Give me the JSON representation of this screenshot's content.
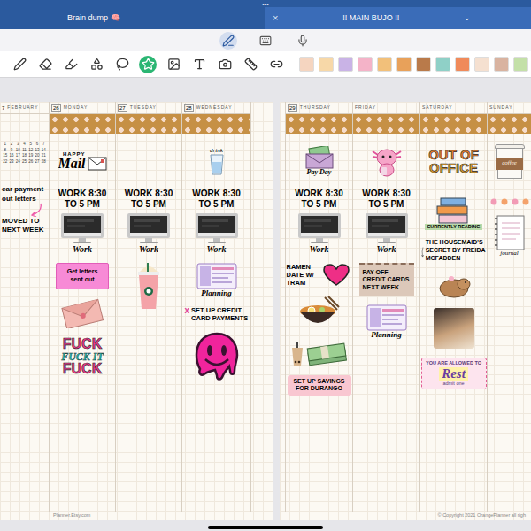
{
  "tab_bar": {
    "more": "•••",
    "close": "×",
    "menu": "⌄"
  },
  "tabs": [
    {
      "label": "Brain dump 🧠",
      "selected": false
    },
    {
      "label": "!! MAIN BUJO !!",
      "selected": true
    }
  ],
  "modes": [
    {
      "kind": "pen",
      "selected": true
    },
    {
      "kind": "keyboard",
      "selected": false
    },
    {
      "kind": "mic",
      "selected": false
    }
  ],
  "tools": [
    {
      "kind": "pen",
      "selected": false
    },
    {
      "kind": "eraser",
      "selected": false
    },
    {
      "kind": "highlighter",
      "selected": false
    },
    {
      "kind": "shapes",
      "selected": false
    },
    {
      "kind": "lasso",
      "selected": false
    },
    {
      "kind": "sticker",
      "selected": true
    },
    {
      "kind": "image",
      "selected": false
    },
    {
      "kind": "text",
      "selected": false
    },
    {
      "kind": "camera",
      "selected": false
    },
    {
      "kind": "ruler",
      "selected": false
    },
    {
      "kind": "link",
      "selected": false
    }
  ],
  "intro": {
    "number": "7",
    "month": "FEBRUARY",
    "mini_calendar": [
      "1",
      "2",
      "3",
      "4",
      "5",
      "6",
      "7",
      "8",
      "9",
      "10",
      "11",
      "12",
      "13",
      "14",
      "15",
      "16",
      "17",
      "18",
      "19",
      "20",
      "21",
      "22",
      "23",
      "24",
      "25",
      "26",
      "27",
      "28"
    ],
    "notes": [
      "car payment",
      "out letters"
    ],
    "moved": "MOVED TO NEXT WEEK"
  },
  "pages": [
    {
      "side": "left",
      "footer": "Planner.Etsy.com",
      "days": [
        {
          "number": "26",
          "name": "MONDAY",
          "top": [
            {
              "kind": "mail",
              "lines": [
                "HAPPY",
                "Mail"
              ]
            }
          ],
          "work": [
            "WORK 8:30",
            "TO 5 PM"
          ],
          "desk": "Work",
          "items": [
            {
              "kind": "sticky",
              "text": "Get letters sent out",
              "color": "#f78ad6"
            },
            {
              "kind": "envelope"
            },
            {
              "kind": "fuck",
              "lines": [
                "FUCK",
                "FUCK IT",
                "FUCK"
              ]
            }
          ]
        },
        {
          "number": "27",
          "name": "TUESDAY",
          "top": [],
          "work": [
            "WORK 8:30",
            "TO 5 PM"
          ],
          "desk": "Work",
          "items": [
            {
              "kind": "frappe"
            }
          ]
        },
        {
          "number": "28",
          "name": "WEDNESDAY",
          "top": [
            {
              "kind": "glass",
              "label": "drink"
            }
          ],
          "work": [
            "WORK 8:30",
            "TO 5 PM"
          ],
          "desk": "Work",
          "items": [
            {
              "kind": "planner",
              "label": "Planning"
            },
            {
              "kind": "task",
              "mark": "x",
              "text": "SET UP CREDIT CARD PAYMENTS"
            },
            {
              "kind": "smiley"
            }
          ]
        }
      ]
    },
    {
      "side": "right",
      "footer": "© Copyright 2021 OrangePlanner all righ",
      "days": [
        {
          "number": "29",
          "name": "THURSDAY",
          "top": [
            {
              "kind": "payday",
              "label": "Pay Day"
            }
          ],
          "work": [
            "WORK 8:30",
            "TO 5 PM"
          ],
          "desk": "Work",
          "items": [
            {
              "kind": "date-note",
              "text": "RAMEN DATE W/ TRAM"
            },
            {
              "kind": "ramen"
            },
            {
              "kind": "boba-money"
            },
            {
              "kind": "banner",
              "text": "SET UP SAVINGS FOR DURANGO"
            }
          ]
        },
        {
          "number": "",
          "name": "FRIDAY",
          "top": [
            {
              "kind": "axolotl"
            }
          ],
          "work": [
            "WORK 8:30",
            "TO 5 PM"
          ],
          "desk": "Work",
          "items": [
            {
              "kind": "paper-note",
              "text": "PAY OFF CREDIT CARDS NEXT WEEK"
            },
            {
              "kind": "planner",
              "label": "Planning"
            }
          ]
        },
        {
          "number": "",
          "name": "SATURDAY",
          "top": [
            {
              "kind": "ooo",
              "lines": [
                "OUT OF",
                "OFFICE"
              ]
            }
          ],
          "work": [],
          "desk": "",
          "items": [
            {
              "kind": "books",
              "label": "CURRENTLY READING"
            },
            {
              "kind": "book-note",
              "text": "THE HOUSEMAID'S SECRET BY FREIDA MCFADDEN"
            },
            {
              "kind": "capybara"
            },
            {
              "kind": "photo"
            },
            {
              "kind": "ticket",
              "lines": [
                "YOU ARE ALLOWED TO",
                "Rest",
                "admit one"
              ]
            }
          ]
        },
        {
          "number": "",
          "name": "SUNDAY",
          "top": [
            {
              "kind": "cup",
              "label": "coffee"
            }
          ],
          "work": [],
          "desk": "",
          "items": [
            {
              "kind": "dots"
            },
            {
              "kind": "journal",
              "label": "journal"
            }
          ]
        }
      ]
    }
  ]
}
